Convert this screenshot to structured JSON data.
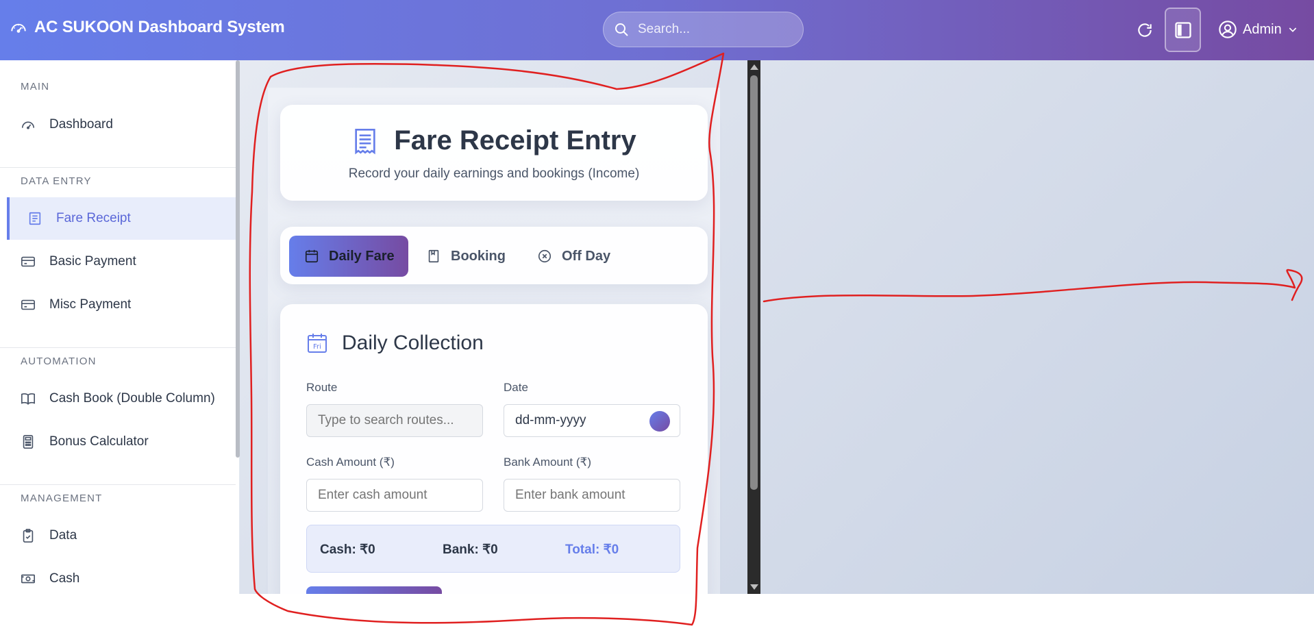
{
  "header": {
    "title": "AC SUKOON Dashboard System",
    "search_placeholder": "Search...",
    "user_label": "Admin"
  },
  "sidebar": {
    "sections": [
      {
        "label": "MAIN",
        "items": [
          {
            "label": "Dashboard",
            "icon": "dashboard-icon"
          }
        ]
      },
      {
        "label": "DATA ENTRY",
        "items": [
          {
            "label": "Fare Receipt",
            "icon": "receipt-icon",
            "active": true
          },
          {
            "label": "Basic Payment",
            "icon": "card-icon"
          },
          {
            "label": "Misc Payment",
            "icon": "card-icon"
          }
        ]
      },
      {
        "label": "AUTOMATION",
        "items": [
          {
            "label": "Cash Book (Double Column)",
            "icon": "book-icon"
          },
          {
            "label": "Bonus Calculator",
            "icon": "calculator-icon"
          }
        ]
      },
      {
        "label": "MANAGEMENT",
        "items": [
          {
            "label": "Data",
            "icon": "clipboard-icon"
          },
          {
            "label": "Cash",
            "icon": "cash-icon"
          }
        ]
      }
    ]
  },
  "page": {
    "title": "Fare Receipt Entry",
    "subtitle": "Record your daily earnings and bookings (Income)"
  },
  "tabs": [
    {
      "label": "Daily Fare",
      "active": true
    },
    {
      "label": "Booking"
    },
    {
      "label": "Off Day"
    }
  ],
  "form": {
    "title": "Daily Collection",
    "calendar_icon_text": "Fri",
    "route_label": "Route",
    "route_placeholder": "Type to search routes...",
    "date_label": "Date",
    "date_value": "dd-mm-yyyy",
    "cash_label": "Cash Amount (₹)",
    "cash_placeholder": "Enter cash amount",
    "bank_label": "Bank Amount (₹)",
    "bank_placeholder": "Enter bank amount",
    "summary": {
      "cash": "Cash: ₹0",
      "bank": "Bank: ₹0",
      "total": "Total: ₹0"
    }
  },
  "colors": {
    "accent": "#667eea",
    "accent_end": "#764ba2",
    "annotation": "#e02020"
  }
}
